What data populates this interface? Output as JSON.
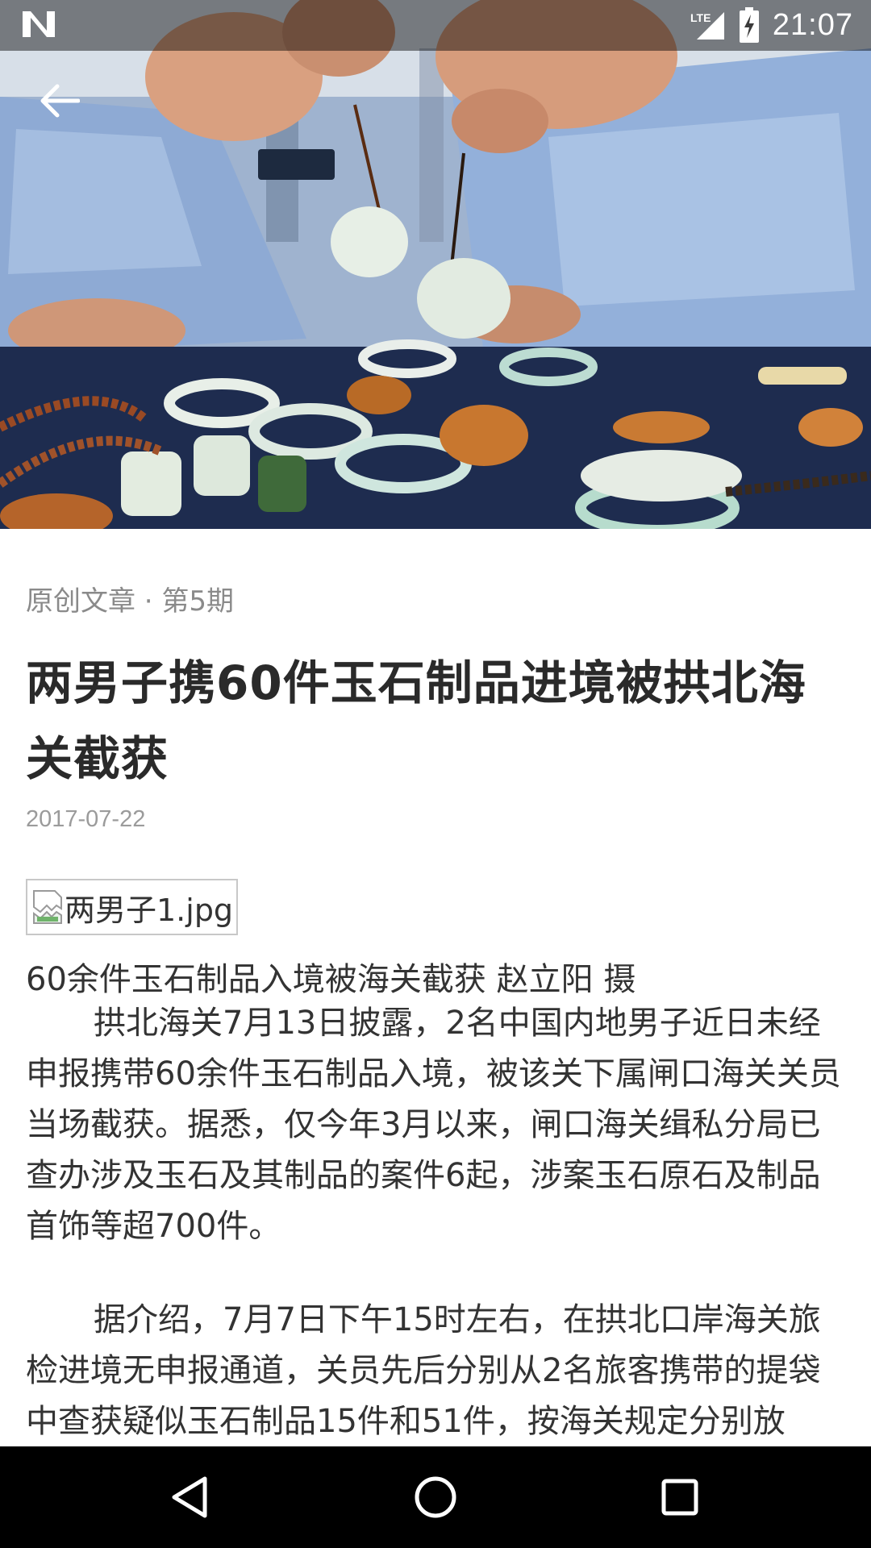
{
  "status_bar": {
    "time": "21:07",
    "network": "LTE"
  },
  "hero_image": {
    "description_icon": "jade-jewelry-photo"
  },
  "article": {
    "meta": "原创文章 · 第5期",
    "title": "两男子携60件玉石制品进境被拱北海关截获",
    "date": "2017-07-22",
    "image_alt": "两男子1.jpg",
    "caption": "60余件玉石制品入境被海关截获 赵立阳 摄",
    "paragraph1": "拱北海关7月13日披露，2名中国内地男子近日未经申报携带60余件玉石制品入境，被该关下属闸口海关关员当场截获。据悉，仅今年3月以来，闸口海关缉私分局已查办涉及玉石及其制品的案件6起，涉案玉石原石及制品首饰等超700件。",
    "paragraph2": "据介绍，7月7日下午15时左右，在拱北口岸海关旅检进境无申报通道，关员先后分别从2名旅客携带的提袋中查获疑似玉石制品15件和51件，按海关规定分别放"
  },
  "colors": {
    "title": "#2a2a2a",
    "body": "#333333",
    "meta": "#8a8a8a",
    "nav_bar": "#000000"
  }
}
